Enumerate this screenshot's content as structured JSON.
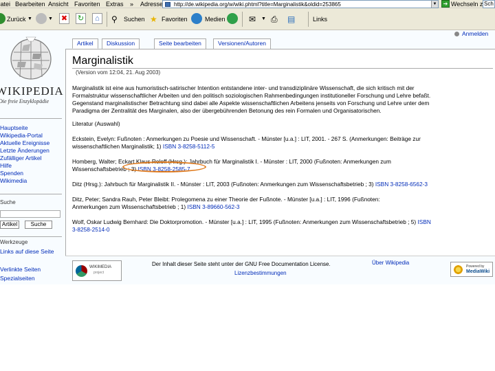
{
  "browser": {
    "menu": [
      "Datei",
      "Bearbeiten",
      "Ansicht",
      "Favoriten",
      "Extras",
      "?"
    ],
    "address_label": "Adresse",
    "address_url": "http://de.wikipedia.org/w/wiki.phtml?title=Marginalistik&oldid=253865",
    "go_label": "Wechseln zu",
    "search_partial": "Sch",
    "toolbar": {
      "back": "Zurück",
      "search": "Suchen",
      "favorites": "Favoriten",
      "media": "Medien",
      "links": "Links"
    }
  },
  "logo": {
    "wordmark": "WIKIPEDIA",
    "slogan": "Die freie Enzyklopädie"
  },
  "sidebar": {
    "nav": [
      "Hauptseite",
      "Wikipedia-Portal",
      "Aktuelle Ereignisse",
      "Letzte Änderungen",
      "Zufälliger Artikel",
      "Hilfe",
      "Spenden",
      "Wikimedia"
    ],
    "search_heading": "Suche",
    "search_buttons": [
      "Artikel",
      "Suche"
    ],
    "tools_heading": "Werkzeuge",
    "tools": [
      "Links auf diese Seite",
      "Verlinkte Seiten",
      "Spezialseiten"
    ]
  },
  "tabs": [
    "Artikel",
    "Diskussion",
    "Seite bearbeiten",
    "Versionen/Autoren"
  ],
  "user": {
    "login": "Anmelden"
  },
  "article": {
    "title": "Marginalistik",
    "version": "(Version vom 12:04, 21. Aug 2003)",
    "intro": [
      "Marginalistik ist eine aus humoristisch-satirischer Intention entstandene inter- und transdiziplinäre Wissenschaft, die sich kritisch mit der",
      "Formalstruktur wissenschaftlicher Arbeiten und den politisch soziologischen Rahmenbedingungen institutioneller Forschung und Lehre befaßt.",
      "Gegenstand marginalistischer Betrachtung sind dabei alle Aspekte wissenschaftlichen Arbeitens jenseits von Forschung und Lehre unter dem",
      "Paradigma der Zentralität des Marginalen, also der übergebührenden Betonung des rein Formalen und Organisatorischen."
    ],
    "lit_heading": "Literatur (Auswahl)",
    "refs": [
      {
        "line1_pre": "Eckstein, Evelyn: Fußnoten : Anmerkungen zu Poesie und Wissenschaft. - Münster [u.a.] : LIT, 2001. - 267 S. (Anmerkungen: Beiträge zur",
        "line2_pre": "wissenschaftlichen Marginalistik; 1) ",
        "isbn": "ISBN 3-8258-5112-5"
      },
      {
        "line1_pre": "Homberg, Walter; ",
        "line1_highlight": "Eckart Klaus Roloff (Hrsg.):",
        "line1_post": " Jahrbuch für Marginalistik I. - Münster : LIT, 2000 (Fußnoten: Anmerkungen zum",
        "line2_pre": "Wissenschaftsbetrieb ; 3) ",
        "isbn": "ISBN 3-8258-2585-7"
      },
      {
        "line1_pre": "Ditz (Hrsg.): Jahrbuch für Marginalistik II. - Münster : LIT, 2003 (Fußnoten: Anmerkungen zum Wissenschaftsbetrieb ; 3) ",
        "isbn": "ISBN 3-8258-6562-3"
      },
      {
        "line1_pre": "Ditz, Peter; Sandra Rauh, Peter Bleibt: Prolegomena zu einer Theorie der Fußnote. - Münster [u.a.] : LIT, 1996 (Fußnoten:",
        "line2_pre": "Anmerkungen zum Wissenschaftsbetrieb ; 1) ",
        "isbn": "ISBN 3-89660-562-3"
      },
      {
        "line1_pre": "Wolf, Oskar Ludwig Bernhard: Die Doktorpromotion. - Münster [u.a.] : LIT, 1995 (Fußnoten: Anmerkungen zum Wissenschaftsbetrieb ; 5) ",
        "line1_isbn_start": "ISBN",
        "line2_isbn": "3-8258-2514-0"
      }
    ]
  },
  "footer": {
    "wikimedia_badge": "WIKIMEDIA",
    "wikimedia_badge_sub": "project",
    "license_line1": "Der Inhalt dieser Seite steht unter der GNU Free Documentation License.",
    "license_line2": "Lizenzbestimmungen",
    "about": "Über Wikipedia",
    "mediawiki_badge1": "Powered by",
    "mediawiki_badge2": "MediaWiki"
  },
  "colors": {
    "link": "#002bb8",
    "highlight": "#e07a1c",
    "chrome": "#ece9d8"
  }
}
